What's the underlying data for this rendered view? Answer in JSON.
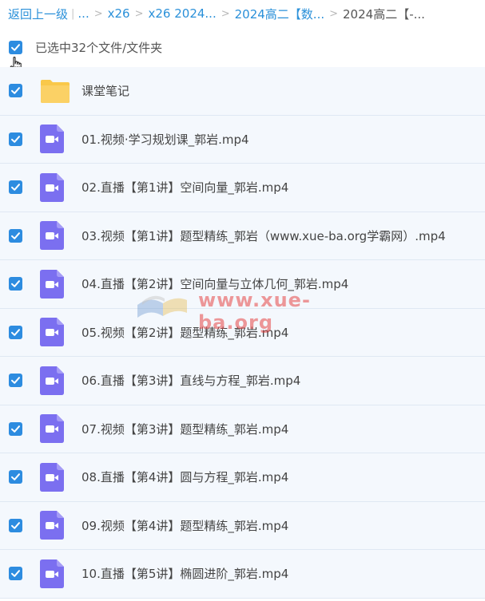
{
  "breadcrumb": {
    "back_label": "返回上一级",
    "bar": "|",
    "ellipsis": "...",
    "sep": ">",
    "items": [
      "x26",
      "x26 2024...",
      "2024高二【数..."
    ],
    "current": "2024高二【-..."
  },
  "selection": {
    "label": "已选中32个文件/文件夹",
    "checked": true
  },
  "files": [
    {
      "name": "课堂笔记",
      "type": "folder"
    },
    {
      "name": "01.视频·学习规划课_郭岩.mp4",
      "type": "video"
    },
    {
      "name": "02.直播【第1讲】空间向量_郭岩.mp4",
      "type": "video"
    },
    {
      "name": "03.视频【第1讲】题型精练_郭岩（www.xue-ba.org学霸网）.mp4",
      "type": "video"
    },
    {
      "name": "04.直播【第2讲】空间向量与立体几何_郭岩.mp4",
      "type": "video"
    },
    {
      "name": "05.视频【第2讲】题型精练_郭岩.mp4",
      "type": "video"
    },
    {
      "name": "06.直播【第3讲】直线与方程_郭岩.mp4",
      "type": "video"
    },
    {
      "name": "07.视频【第3讲】题型精练_郭岩.mp4",
      "type": "video"
    },
    {
      "name": "08.直播【第4讲】圆与方程_郭岩.mp4",
      "type": "video"
    },
    {
      "name": "09.视频【第4讲】题型精练_郭岩.mp4",
      "type": "video"
    },
    {
      "name": "10.直播【第5讲】椭圆进阶_郭岩.mp4",
      "type": "video"
    }
  ],
  "watermark": {
    "text": "www.xue-ba.org"
  },
  "colors": {
    "link": "#2a90d9",
    "checkbox": "#2d8ce0",
    "folder": "#f9c84a",
    "video_icon": "#7b6ff0",
    "row_bg": "#f4f8fd"
  },
  "icons": {
    "checkbox": "checkmark-icon",
    "folder": "folder-icon",
    "video": "video-file-icon",
    "cursor": "hand-pointer-icon"
  }
}
